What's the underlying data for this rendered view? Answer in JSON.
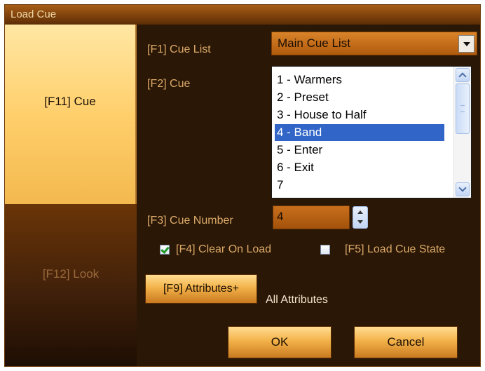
{
  "window": {
    "title": "Load Cue"
  },
  "sidebar": {
    "cue_tab": "[F11] Cue",
    "look_tab": "[F12] Look"
  },
  "cue_list": {
    "label": "[F1] Cue List",
    "value": "Main Cue List"
  },
  "cue": {
    "label": "[F2] Cue",
    "items": [
      "1 - Warmers",
      "2 - Preset",
      "3 - House to Half",
      "4 - Band",
      "5 - Enter",
      "6 - Exit",
      "7"
    ],
    "selected": "4 - Band"
  },
  "cue_number": {
    "label": "[F3] Cue Number",
    "value": "4"
  },
  "options": {
    "clear_on_load": {
      "label": "[F4] Clear On Load",
      "checked": true
    },
    "load_cue_state": {
      "label": "[F5] Load Cue State",
      "checked": false
    }
  },
  "attributes": {
    "button": "[F9] Attributes+",
    "value": "All Attributes"
  },
  "buttons": {
    "ok": "OK",
    "cancel": "Cancel"
  }
}
